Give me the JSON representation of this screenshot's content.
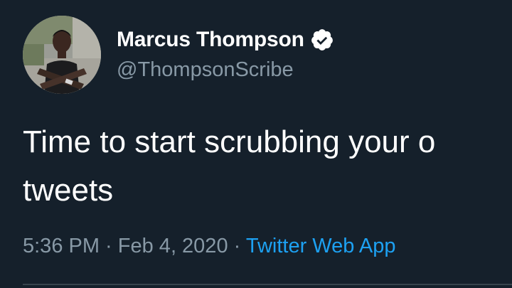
{
  "author": {
    "display_name": "Marcus Thompson",
    "handle": "@ThompsonScribe",
    "verified": true,
    "avatar": "profile-photo"
  },
  "tweet": {
    "line1": "Time to start scrubbing your o",
    "line2": "tweets"
  },
  "meta": {
    "time": "5:36 PM",
    "separator": " · ",
    "date": "Feb 4, 2020",
    "source": "Twitter Web App"
  },
  "colors": {
    "background": "#15202b",
    "text_primary": "#ffffff",
    "text_secondary": "#8899a6",
    "link": "#1da1f2",
    "divider": "#38444d"
  }
}
